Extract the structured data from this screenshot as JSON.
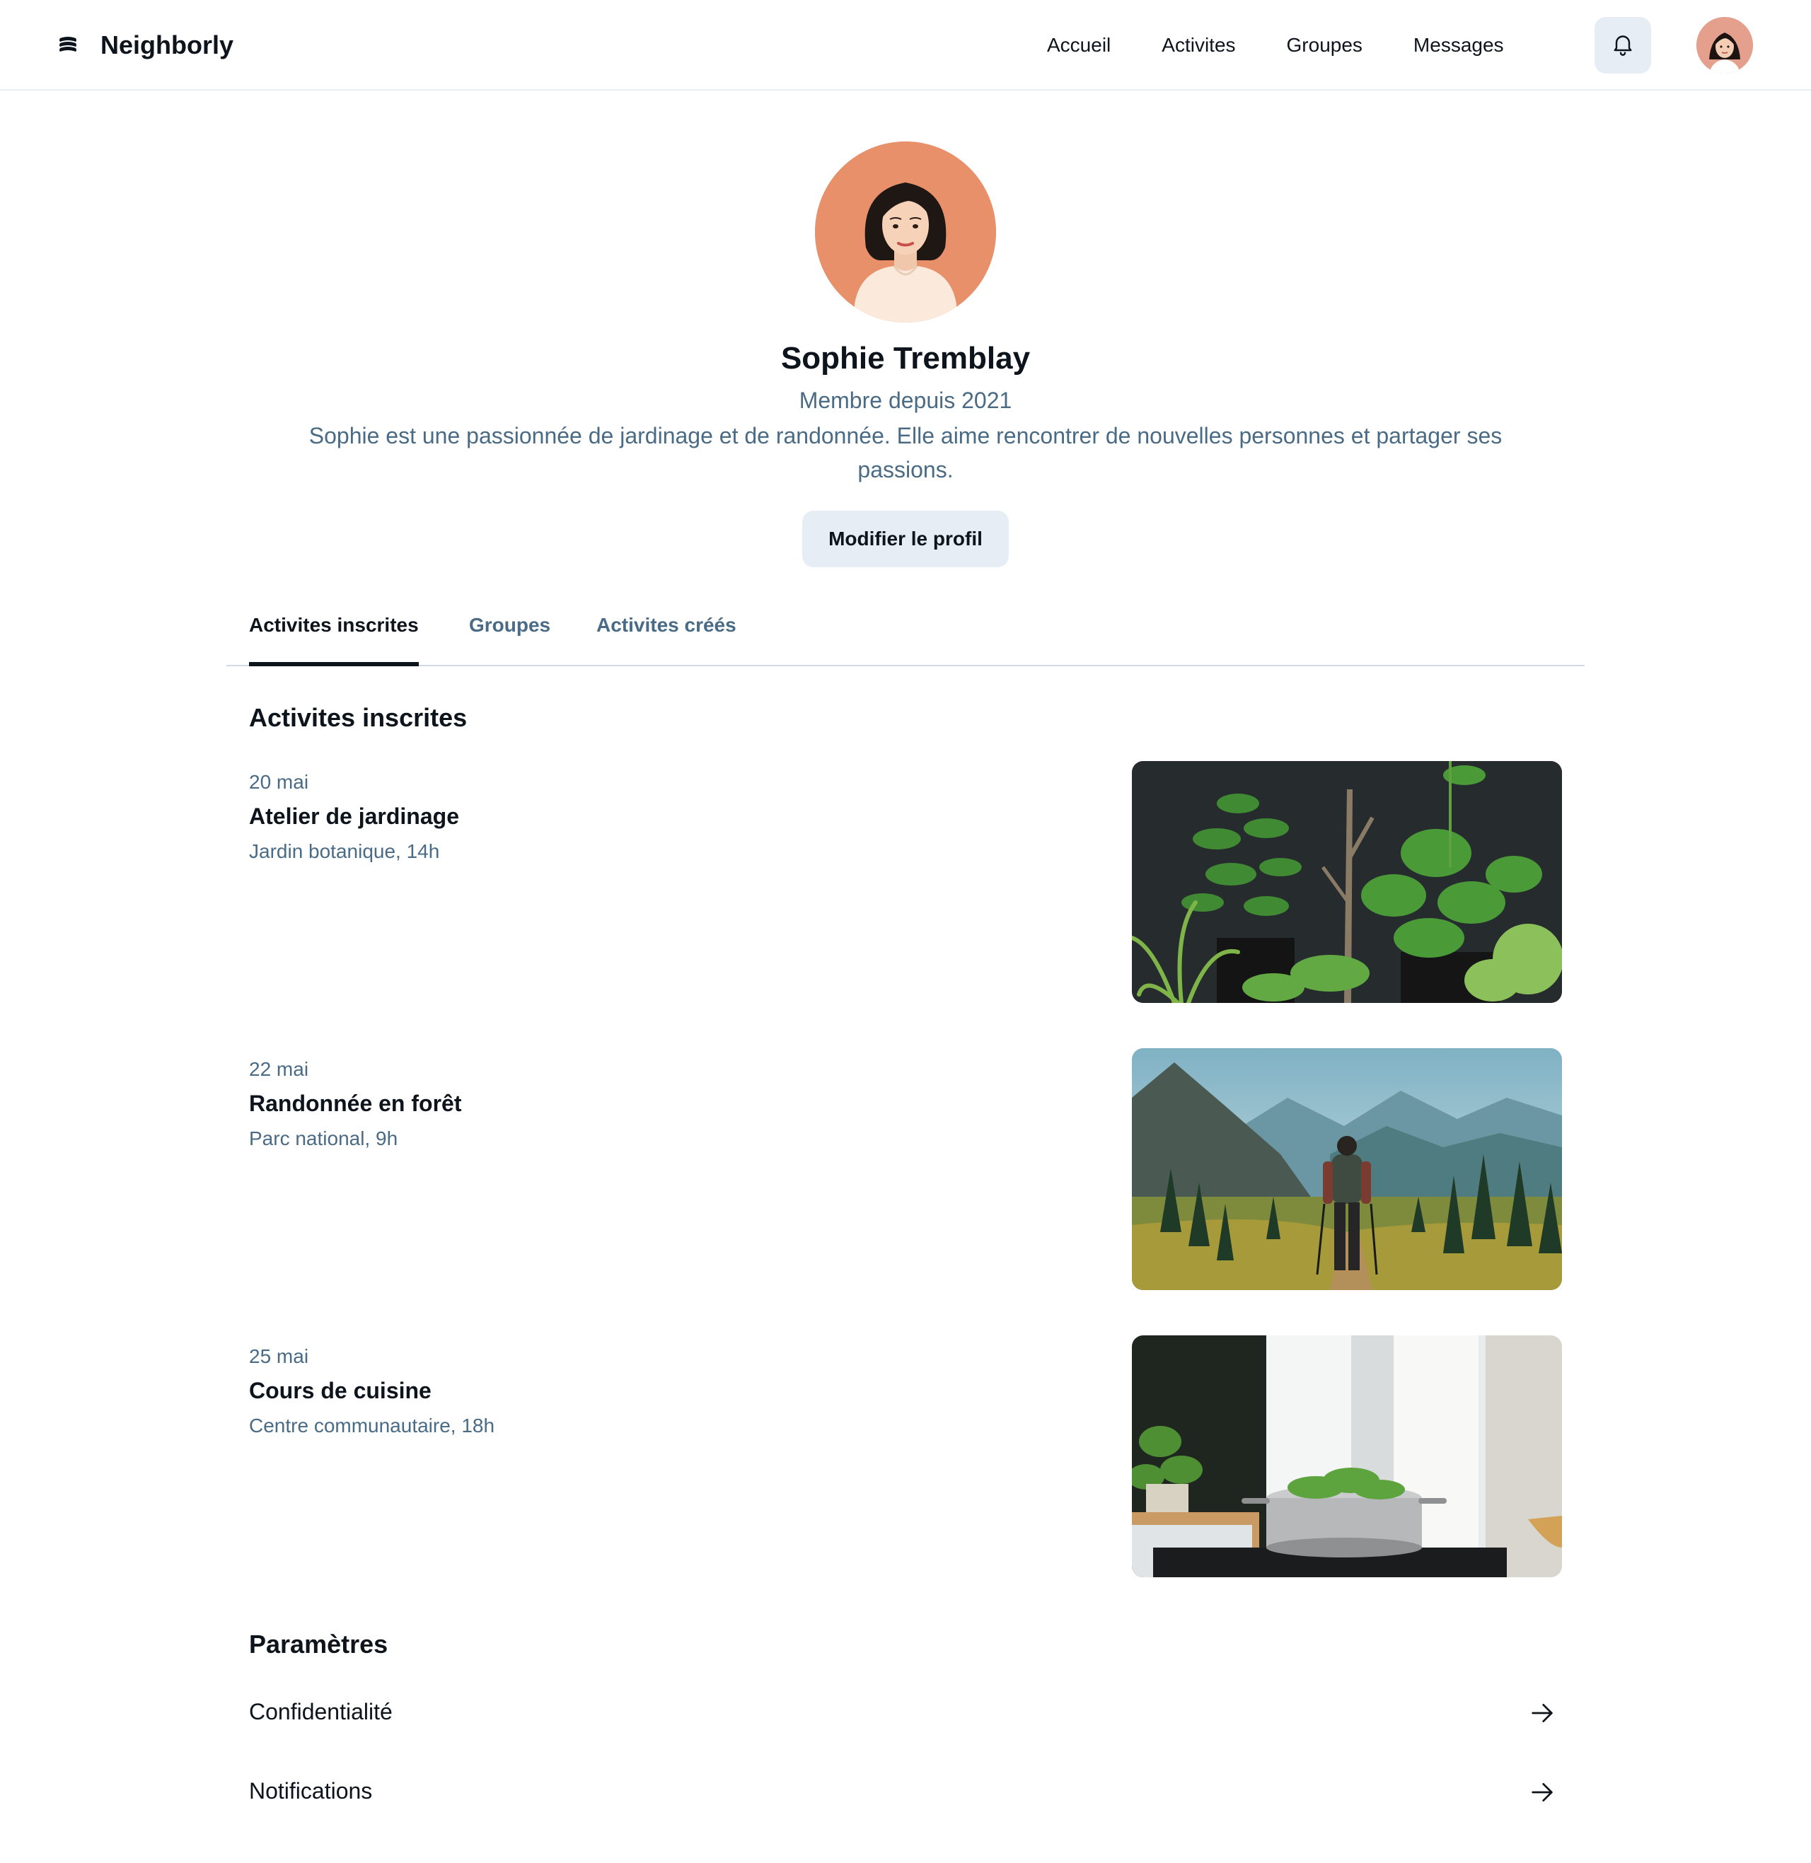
{
  "header": {
    "brand": "Neighborly",
    "nav": [
      "Accueil",
      "Activites",
      "Groupes",
      "Messages"
    ]
  },
  "profile": {
    "name": "Sophie Tremblay",
    "since": "Membre depuis 2021",
    "bio": "Sophie est une passionnée de jardinage et de randonnée. Elle aime rencontrer de nouvelles personnes et partager ses passions.",
    "edit_label": "Modifier le profil"
  },
  "tabs": [
    "Activites inscrites",
    "Groupes",
    "Activites créés"
  ],
  "activities_section": {
    "title": "Activites inscrites",
    "items": [
      {
        "date": "20 mai",
        "title": "Atelier de jardinage",
        "location": "Jardin botanique, 14h"
      },
      {
        "date": "22 mai",
        "title": "Randonnée en forêt",
        "location": "Parc national, 9h"
      },
      {
        "date": "25 mai",
        "title": "Cours de cuisine",
        "location": "Centre communautaire, 18h"
      }
    ]
  },
  "settings": {
    "title": "Paramètres",
    "items": [
      "Confidentialité",
      "Notifications"
    ]
  },
  "colors": {
    "text_primary": "#0d141c",
    "text_secondary": "#4a6b85",
    "button_bg": "#e7edf4",
    "avatar_bg": "#e8906a"
  }
}
